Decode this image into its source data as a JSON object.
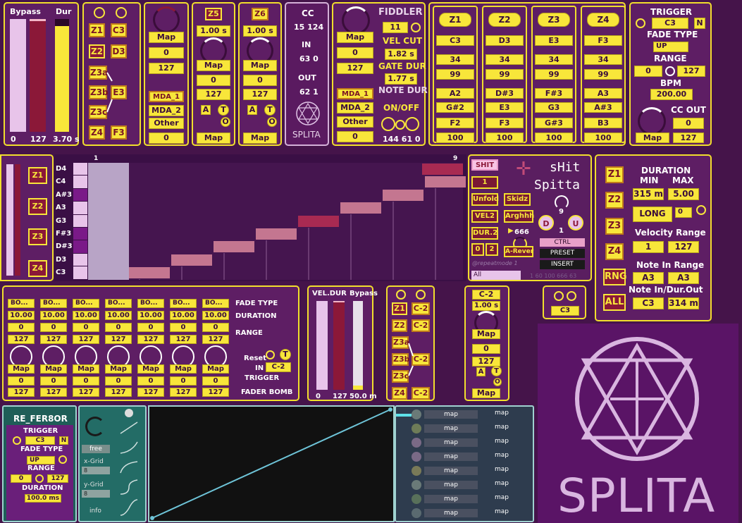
{
  "bypass_dur": {
    "bypass": "Bypass",
    "dur": "Dur",
    "v0": "0",
    "v1": "127",
    "v2": "3.70 s"
  },
  "zone_select": {
    "z1": "Z1",
    "z2": "Z2",
    "z3a": "Z3a",
    "z3b": "Z3b",
    "z3c": "Z3c",
    "z4": "Z4",
    "c3": "C3",
    "d3": "D3",
    "e3": "E3",
    "f3": "F3"
  },
  "mapper": {
    "map": "Map",
    "v1": "0",
    "v2": "127",
    "mda1": "MDA_1",
    "mda2": "MDA_2",
    "other": "Other",
    "v3": "0"
  },
  "z5": {
    "label": "Z5",
    "time": "1.00 s",
    "map1": "Map",
    "v1": "0",
    "v2": "127",
    "a": "A",
    "t": "T",
    "o": "O",
    "map2": "Map"
  },
  "z6": {
    "label": "Z6",
    "time": "1.00 s",
    "map1": "Map",
    "v1": "0",
    "v2": "127",
    "a": "A",
    "t": "T",
    "o": "O",
    "map2": "Map"
  },
  "cc": {
    "title": "CC",
    "val1": "15 124",
    "in": "IN",
    "in_val": "63 0",
    "out": "OUT",
    "out_val": "62 1",
    "brand": "SPLITA"
  },
  "fiddler": {
    "title": "FIDDLER",
    "v1": "11",
    "vel_cut": "VEL CUT",
    "vel_cut_val": "1.82 s",
    "gate_dur": "GATE DUR",
    "gate_dur_val": "1.77 s",
    "note_dur": "NOTE DUR",
    "onoff": "ON/OFF",
    "onoff_val": "144 61 0",
    "map": "Map",
    "m1": "0",
    "m2": "127",
    "mda1": "MDA_1",
    "mda2": "MDA_2",
    "other": "Other",
    "m3": "0"
  },
  "zones": [
    {
      "label": "Z1",
      "note": "C3",
      "v1": "34",
      "v2": "99",
      "lo": "A2",
      "mid": "G#2",
      "hi": "F2",
      "vel": "100"
    },
    {
      "label": "Z2",
      "note": "D3",
      "v1": "34",
      "v2": "99",
      "lo": "D#3",
      "mid": "E3",
      "hi": "F3",
      "vel": "100"
    },
    {
      "label": "Z3",
      "note": "E3",
      "v1": "34",
      "v2": "99",
      "lo": "F#3",
      "mid": "G3",
      "hi": "G#3",
      "vel": "100"
    },
    {
      "label": "Z4",
      "note": "F3",
      "v1": "34",
      "v2": "99",
      "lo": "A3",
      "mid": "A#3",
      "hi": "B3",
      "vel": "100"
    }
  ],
  "trigger": {
    "title": "TRIGGER",
    "note": "C3",
    "n": "N",
    "fade_type": "FADE TYPE",
    "fade_val": "UP",
    "range": "RANGE",
    "r1": "0",
    "r2": "127",
    "bpm": "BPM",
    "bpm_val": "200.00",
    "cc_out": "CC OUT",
    "cc1": "0",
    "cc2": "127",
    "map": "Map"
  },
  "zone_side": {
    "z1": "Z1",
    "z2": "Z2",
    "z3": "Z3",
    "z4": "Z4"
  },
  "roll": {
    "notes": [
      "D4",
      "C4",
      "A#3",
      "A3",
      "G3",
      "F#3",
      "D#3",
      "D3",
      "C3"
    ],
    "start": "1",
    "end": "9"
  },
  "shit": {
    "btn": "SHIT",
    "v1": "1",
    "unfold": "Unfold",
    "skidz": "Skidz",
    "vel2": "VEL2",
    "arghhh": "Arghhh",
    "dur2": "DUR.2",
    "v666": "666",
    "z0": "0",
    "z2": "2",
    "arever": "A-Rever",
    "title1": "sHit",
    "title2": "Spitta",
    "nine": "9",
    "d": "D",
    "u": "U",
    "one": "1",
    "ctrl": "CTRL",
    "preset": "PRESET",
    "insert": "INSERT",
    "mode": "@repeatmode 1",
    "all": "All",
    "nums": "1 60 100 666 63"
  },
  "duration_panel": {
    "z1": "Z1",
    "z2": "Z2",
    "z3": "Z3",
    "z4": "Z4",
    "rng": "RNG",
    "all": "ALL",
    "title": "DURATION",
    "min": "MIN",
    "max": "MAX",
    "min_val": "315 m",
    "max_val": "5.00",
    "long": "LONG",
    "zero": "0",
    "vel_range": "Velocity Range",
    "vr1": "1",
    "vr2": "127",
    "note_range": "Note In Range",
    "nr1": "A3",
    "nr2": "A3",
    "note_io": "Note In/Dur.Out",
    "nio1": "C3",
    "nio2": "314 m"
  },
  "faders": {
    "cols": [
      {
        "type": "BO...",
        "dur": "10.00",
        "r1": "0",
        "r2": "127",
        "map": "Map",
        "m1": "0",
        "m2": "127"
      },
      {
        "type": "BO...",
        "dur": "10.00",
        "r1": "0",
        "r2": "127",
        "map": "Map",
        "m1": "0",
        "m2": "127"
      },
      {
        "type": "BO...",
        "dur": "10.00",
        "r1": "0",
        "r2": "127",
        "map": "Map",
        "m1": "0",
        "m2": "127"
      },
      {
        "type": "BO...",
        "dur": "10.00",
        "r1": "0",
        "r2": "127",
        "map": "Map",
        "m1": "0",
        "m2": "127"
      },
      {
        "type": "BO...",
        "dur": "10.00",
        "r1": "0",
        "r2": "127",
        "map": "Map",
        "m1": "0",
        "m2": "127"
      },
      {
        "type": "BO...",
        "dur": "10.00",
        "r1": "0",
        "r2": "127",
        "map": "Map",
        "m1": "0",
        "m2": "127"
      },
      {
        "type": "BO...",
        "dur": "10.00",
        "r1": "0",
        "r2": "127",
        "map": "Map",
        "m1": "0",
        "m2": "127"
      }
    ],
    "fade_type": "FADE TYPE",
    "duration": "DURATION",
    "range": "RANGE",
    "reset": "Reset",
    "t": "T",
    "in": "IN",
    "in_val": "C-2",
    "trigger": "TRIGGER",
    "bomb": "FADER BOMB"
  },
  "veldur": {
    "title": "VEL.DUR",
    "bypass": "Bypass",
    "v0": "0",
    "v1": "127",
    "v2": "50.0 m"
  },
  "zone_select2": {
    "z1": "Z1",
    "z2": "Z2",
    "z3a": "Z3a",
    "z3b": "Z3b",
    "z3c": "Z3c",
    "z4": "Z4",
    "c2a": "C-2",
    "c2b": "C-2",
    "c2c": "C-2",
    "c2d": "C-2"
  },
  "pulse": {
    "note": "C-2",
    "time": "1.00 s",
    "map": "Map",
    "v1": "0",
    "v2": "127",
    "a": "A",
    "t": "T",
    "o": "O",
    "map2": "Map"
  },
  "mini": {
    "note": "C3"
  },
  "logo": {
    "text": "SPLITA"
  },
  "refer": {
    "title": "RE_FER8OR",
    "trigger": "TRIGGER",
    "note": "C3",
    "n": "N",
    "fade_type": "FADE TYPE",
    "fade_val": "UP",
    "range": "RANGE",
    "r1": "0",
    "r2": "127",
    "duration": "DURATION",
    "dur_val": "100.0 ms"
  },
  "curve_tools": {
    "free": "free",
    "xgrid": "x-Grid",
    "xval": "8",
    "ygrid": "y-Grid",
    "yval": "8",
    "info": "info"
  },
  "maplist": {
    "rows": [
      {
        "btn": "map",
        "label": "map"
      },
      {
        "btn": "map",
        "label": "map"
      },
      {
        "btn": "map",
        "label": "map"
      },
      {
        "btn": "map",
        "label": "map"
      },
      {
        "btn": "map",
        "label": "map"
      },
      {
        "btn": "map",
        "label": "map"
      },
      {
        "btn": "map",
        "label": "map"
      },
      {
        "btn": "map",
        "label": "map"
      }
    ]
  }
}
